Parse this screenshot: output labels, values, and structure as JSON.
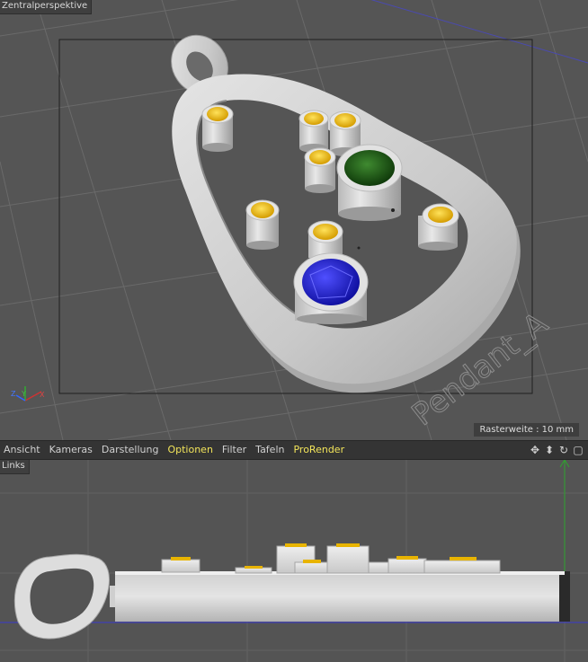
{
  "top_view": {
    "label": "Zentralperspektive",
    "watermark": "Pendant_A",
    "grid_info": "Rasterweite : 10 mm",
    "axes": {
      "x": "X",
      "y": "Y",
      "z": "Z"
    }
  },
  "bottom_view": {
    "label": "Links"
  },
  "menubar": {
    "items": [
      {
        "label": "Ansicht"
      },
      {
        "label": "Kameras"
      },
      {
        "label": "Darstellung"
      },
      {
        "label": "Optionen"
      },
      {
        "label": "Filter"
      },
      {
        "label": "Tafeln"
      },
      {
        "label": "ProRender"
      }
    ],
    "active_item": "Optionen",
    "prorender_color": "#f2e45a",
    "icons": [
      "move-icon",
      "down-arrow-icon",
      "rotate-icon",
      "maximize-icon"
    ]
  },
  "colors": {
    "viewport_bg": "#555555",
    "gem_yellow": "#e8b400",
    "gem_green": "#1f5f17",
    "gem_blue": "#1a1ad2",
    "metal": "#d0d0d0"
  }
}
